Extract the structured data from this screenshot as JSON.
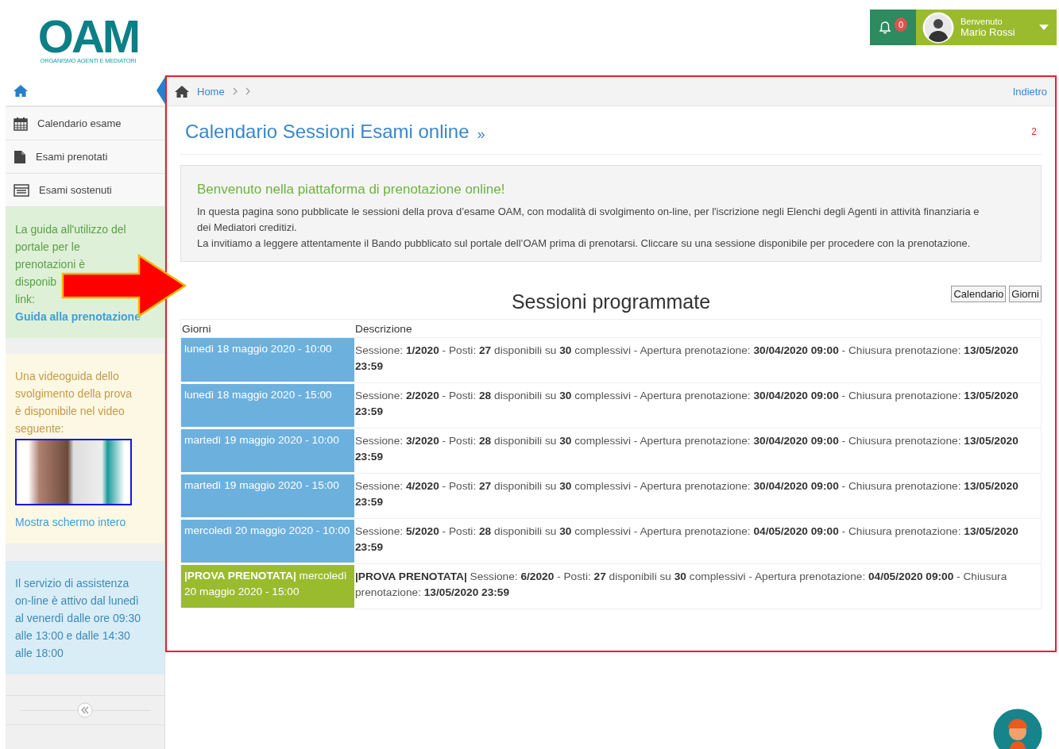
{
  "header": {
    "logo": {
      "mark": "OAM",
      "subtitle": "ORGANISMO AGENTI E MEDIATORI"
    },
    "notifications": {
      "count": "0"
    },
    "user": {
      "greeting": "Benvenuto",
      "name": "Mario Rossi"
    }
  },
  "sidebar": {
    "items": [
      {
        "kind": "calendar",
        "label": "Calendario esame"
      },
      {
        "kind": "document",
        "label": "Esami prenotati"
      },
      {
        "kind": "list",
        "label": "Esami sostenuti"
      }
    ],
    "guide_box": {
      "text": "La guida all'utilizzo del portale per le prenotazioni è",
      "text_cut": "disponib",
      "text_end": "link:",
      "link": "Guida alla prenotazione"
    },
    "video_box": {
      "text": "Una videoguida dello svolgimento della prova è disponibile nel video seguente:",
      "link": "Mostra schermo intero"
    },
    "support_box": {
      "text": "Il servizio di assistenza on-line è attivo dal lunedì al venerdì dalle ore 09:30 alle 13:00 e dalle 14:30 alle 18:00"
    }
  },
  "breadcrumb": {
    "items": [
      "Home"
    ],
    "back": "Indietro"
  },
  "page_title": {
    "text": "Calendario Sessioni Esami online",
    "suffix": "»",
    "marker": "2"
  },
  "welcome": {
    "title": "Benvenuto nella piattaforma di prenotazione online!",
    "paragraphs": [
      "In questa pagina sono pubblicate le sessioni della prova d’esame OAM, con modalità di svolgimento on-line, per l'iscrizione negli Elenchi degli Agenti in attività finanziaria e dei Mediatori creditizi.",
      "La invitiamo a leggere attentamente il Bando pubblicato sul portale dell’OAM prima di prenotarsi. Cliccare su una sessione disponibile per procedere con la prenotazione."
    ]
  },
  "sessions": {
    "title": "Sessioni programmate",
    "view_buttons": [
      {
        "label": "Calendario"
      },
      {
        "label": "Giorni"
      }
    ],
    "columns": [
      "Giorni",
      "Descrizione"
    ],
    "rows": [
      {
        "kind": "available",
        "day": "lunedì 18 maggio 2020 - 10:00",
        "description": "Sessione: **1/2020** - Posti: **27** disponibili su **30** complessivi - Apertura prenotazione: **30/04/2020 09:00** - Chiusura prenotazione: **13/05/2020 23:59**"
      },
      {
        "kind": "available",
        "day": "lunedì 18 maggio 2020 - 15:00",
        "description": "Sessione: **2/2020** - Posti: **28** disponibili su **30** complessivi - Apertura prenotazione: **30/04/2020 09:00** - Chiusura prenotazione: **13/05/2020 23:59**"
      },
      {
        "kind": "available",
        "day": "martedì 19 maggio 2020 - 10:00",
        "description": "Sessione: **3/2020** - Posti: **28** disponibili su **30** complessivi - Apertura prenotazione: **30/04/2020 09:00** - Chiusura prenotazione: **13/05/2020 23:59**"
      },
      {
        "kind": "available",
        "day": "martedì 19 maggio 2020 - 15:00",
        "description": "Sessione: **4/2020** - Posti: **27** disponibili su **30** complessivi - Apertura prenotazione: **30/04/2020 09:00** - Chiusura prenotazione: **13/05/2020 23:59**"
      },
      {
        "kind": "available",
        "day": "mercoledì 20 maggio 2020 - 10:00",
        "description": "Sessione: **5/2020** - Posti: **28** disponibili su **30** complessivi - Apertura prenotazione: **04/05/2020 09:00** - Chiusura prenotazione: **13/05/2020 23:59**"
      },
      {
        "kind": "booked",
        "day": "**|PROVA PRENOTATA|** mercoledì 20 maggio 2020 - 15:00",
        "description": "**|PROVA PRENOTATA|** Sessione: **6/2020** - Posti: **27** disponibili su **30** complessivi - Apertura prenotazione: **04/05/2020 09:00** - Chiusura prenotazione: **13/05/2020 23:59**"
      }
    ]
  }
}
